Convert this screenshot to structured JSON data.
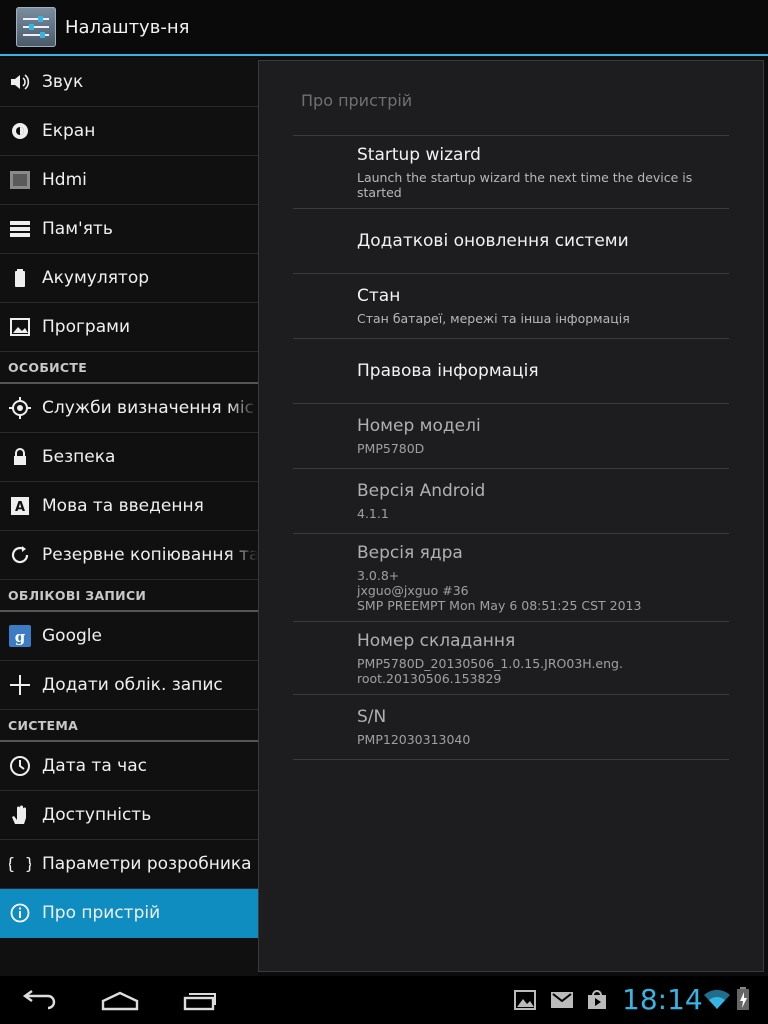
{
  "actionbar": {
    "title": "Налаштув-ня"
  },
  "sidebar": {
    "groups": [
      {
        "items": [
          {
            "icon": "volume-icon",
            "label": "Звук"
          },
          {
            "icon": "brightness-icon",
            "label": "Екран"
          },
          {
            "icon": "hdmi-icon",
            "label": "Hdmi"
          },
          {
            "icon": "storage-icon",
            "label": "Пам'ять"
          },
          {
            "icon": "battery-icon",
            "label": "Акумулятор"
          },
          {
            "icon": "apps-icon",
            "label": "Програми"
          }
        ]
      },
      {
        "header": "ОСОБИСТЕ",
        "items": [
          {
            "icon": "location-icon",
            "label": "Служби визначення міс"
          },
          {
            "icon": "lock-icon",
            "label": "Безпека"
          },
          {
            "icon": "language-icon",
            "label": "Мова та введення"
          },
          {
            "icon": "backup-icon",
            "label": "Резервне копіювання та"
          }
        ]
      },
      {
        "header": "ОБЛІКОВІ ЗАПИСИ",
        "items": [
          {
            "icon": "google-icon",
            "label": "Google"
          },
          {
            "icon": "add-icon",
            "label": "Додати облік. запис"
          }
        ]
      },
      {
        "header": "СИСТЕМА",
        "items": [
          {
            "icon": "clock-icon",
            "label": "Дата та час"
          },
          {
            "icon": "accessibility-icon",
            "label": "Доступність"
          },
          {
            "icon": "developer-icon",
            "label": "Параметри розробника"
          },
          {
            "icon": "info-icon",
            "label": "Про пристрій"
          }
        ]
      }
    ],
    "active_label": "Про пристрій"
  },
  "detail": {
    "title": "Про пристрій",
    "prefs": [
      {
        "title": "Startup wizard",
        "summary": "Launch the startup wizard the next time the device is\nstarted"
      },
      {
        "title": "Додаткові оновлення системи",
        "summary": ""
      },
      {
        "title": "Стан",
        "summary": "Стан батареї, мережі та інша інформація"
      },
      {
        "title": "Правова інформація",
        "summary": ""
      },
      {
        "title": "Номер моделі",
        "summary": "PMP5780D"
      },
      {
        "title": "Версія Android",
        "summary": "4.1.1"
      },
      {
        "title": "Версія ядра",
        "summary": "3.0.8+\njxguo@jxguo #36\nSMP PREEMPT Mon May 6 08:51:25 CST 2013"
      },
      {
        "title": "Номер складання",
        "summary": "PMP5780D_20130506_1.0.15.JRO03H.eng.\nroot.20130506.153829"
      },
      {
        "title": "S/N",
        "summary": "PMP12030313040"
      }
    ]
  },
  "navbar": {
    "buttons": [
      "back-icon",
      "home-icon",
      "recents-icon"
    ],
    "tray_icons": [
      "gallery-icon",
      "gmail-icon",
      "play-store-icon",
      "wifi-icon",
      "battery-charging-icon"
    ],
    "clock": "18:14"
  },
  "colors": {
    "accent": "#33b5e5",
    "active": "#0f8cc0"
  }
}
